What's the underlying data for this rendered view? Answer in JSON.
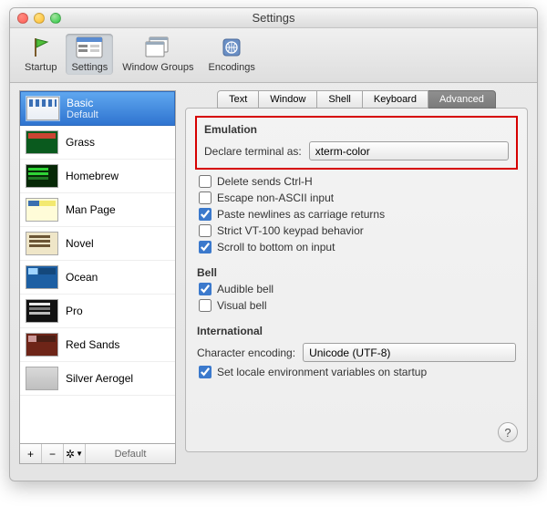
{
  "window": {
    "title": "Settings"
  },
  "toolbar": {
    "items": [
      {
        "label": "Startup"
      },
      {
        "label": "Settings"
      },
      {
        "label": "Window Groups"
      },
      {
        "label": "Encodings"
      }
    ]
  },
  "sidebar": {
    "profiles": [
      {
        "name": "Basic",
        "sub": "Default"
      },
      {
        "name": "Grass"
      },
      {
        "name": "Homebrew"
      },
      {
        "name": "Man Page"
      },
      {
        "name": "Novel"
      },
      {
        "name": "Ocean"
      },
      {
        "name": "Pro"
      },
      {
        "name": "Red Sands"
      },
      {
        "name": "Silver Aerogel"
      }
    ],
    "controls": {
      "add": "+",
      "remove": "−",
      "gear": "✻▾",
      "default_label": "Default"
    }
  },
  "tabs": [
    "Text",
    "Window",
    "Shell",
    "Keyboard",
    "Advanced"
  ],
  "panel": {
    "emulation": {
      "title": "Emulation",
      "declare_label": "Declare terminal as:",
      "declare_value": "xterm-color",
      "opts": [
        {
          "label": "Delete sends Ctrl-H",
          "checked": false
        },
        {
          "label": "Escape non-ASCII input",
          "checked": false
        },
        {
          "label": "Paste newlines as carriage returns",
          "checked": true
        },
        {
          "label": "Strict VT-100 keypad behavior",
          "checked": false
        },
        {
          "label": "Scroll to bottom on input",
          "checked": true
        }
      ]
    },
    "bell": {
      "title": "Bell",
      "opts": [
        {
          "label": "Audible bell",
          "checked": true
        },
        {
          "label": "Visual bell",
          "checked": false
        }
      ]
    },
    "intl": {
      "title": "International",
      "encoding_label": "Character encoding:",
      "encoding_value": "Unicode (UTF-8)",
      "opts": [
        {
          "label": "Set locale environment variables on startup",
          "checked": true
        }
      ]
    }
  },
  "help": "?"
}
